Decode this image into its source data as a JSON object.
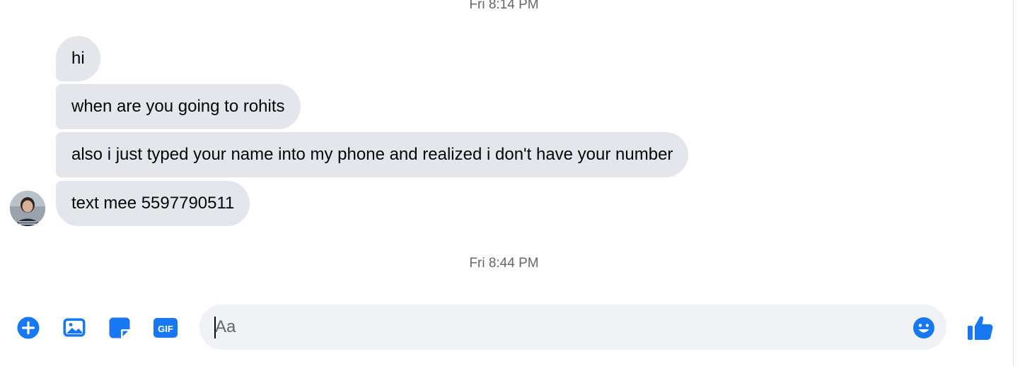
{
  "messages": {
    "timestamp_top": "Fri 8:14 PM",
    "timestamp_bottom": "Fri 8:44 PM",
    "items": [
      {
        "text": "hi"
      },
      {
        "text": "when are you going to rohits"
      },
      {
        "text": "also i just typed your name into my phone and realized i don't have your number"
      },
      {
        "text": "text mee 5597790511"
      }
    ]
  },
  "composer": {
    "placeholder": "Aa",
    "value": "",
    "icons": [
      "plus-circle-icon",
      "image-icon",
      "sticker-icon",
      "gif-icon",
      "emoji-icon",
      "thumbs-up-icon"
    ],
    "gif_label": "GIF"
  },
  "colors": {
    "accent": "#1877f2",
    "bubble": "#e4e6eb",
    "input_bg": "#f0f2f5",
    "timestamp": "#65676b"
  }
}
